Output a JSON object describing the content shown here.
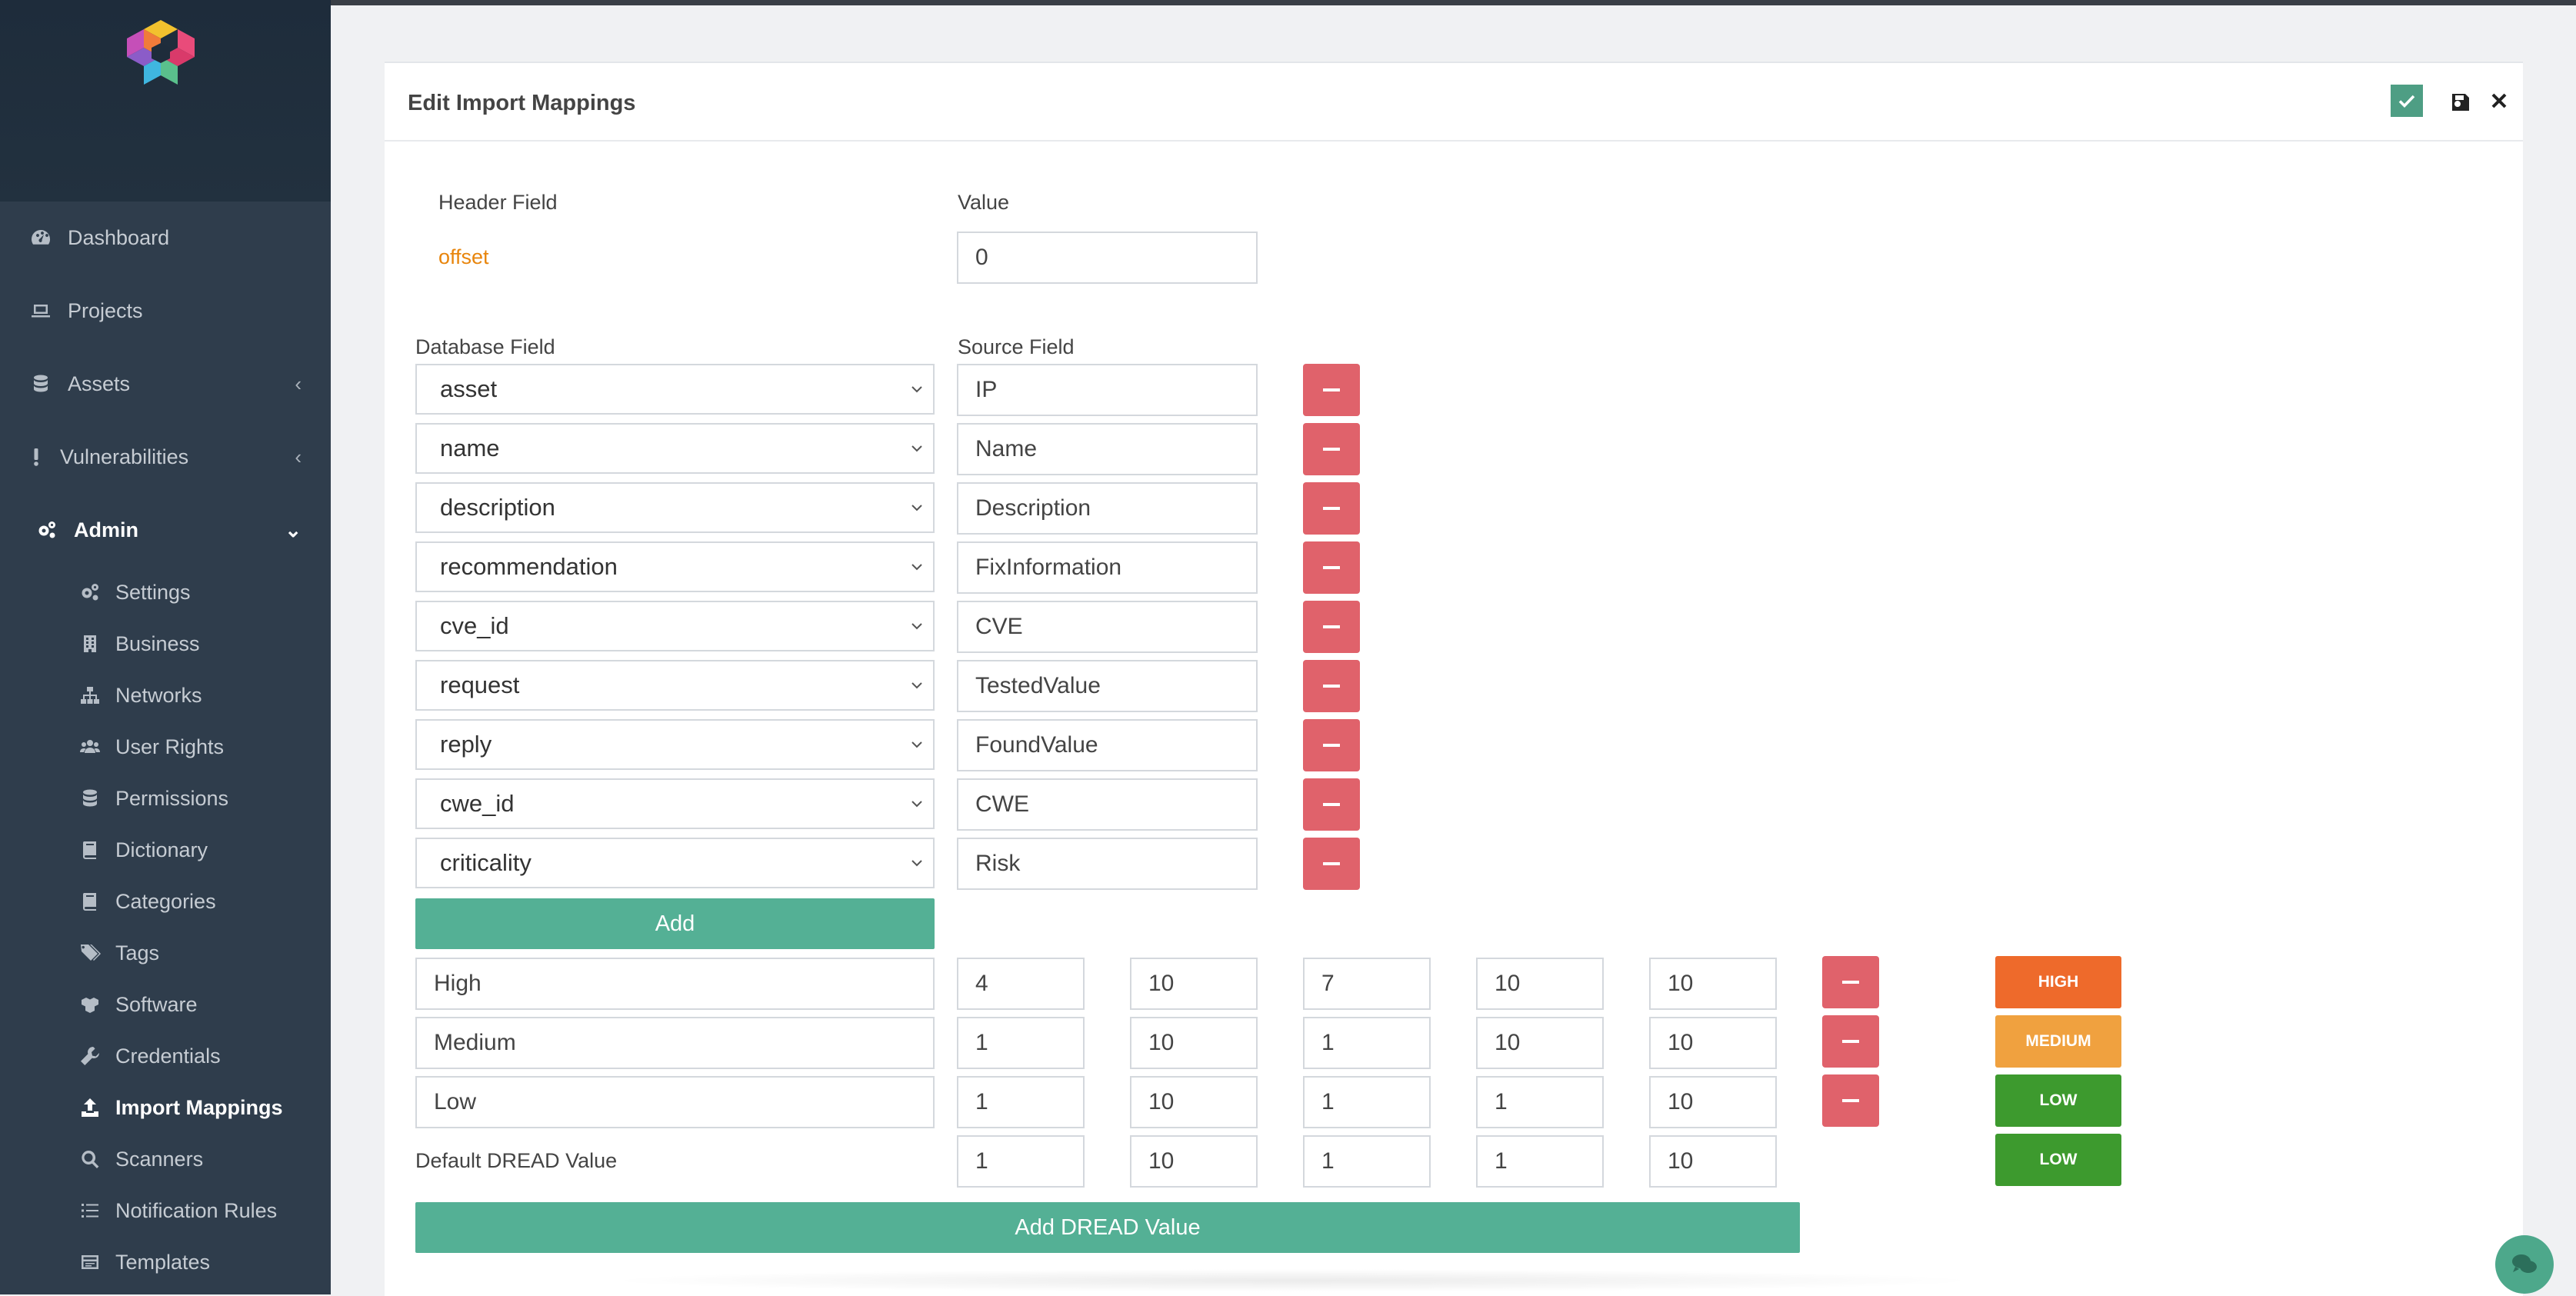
{
  "sidebar": {
    "items": [
      {
        "label": "Dashboard",
        "icon": "gauge-icon"
      },
      {
        "label": "Projects",
        "icon": "laptop-icon"
      },
      {
        "label": "Assets",
        "icon": "database-icon"
      },
      {
        "label": "Vulnerabilities",
        "icon": "exclamation-icon"
      },
      {
        "label": "Admin",
        "icon": "gears-icon"
      }
    ],
    "admin_items": [
      {
        "label": "Settings",
        "icon": "gears-icon"
      },
      {
        "label": "Business",
        "icon": "building-icon"
      },
      {
        "label": "Networks",
        "icon": "sitemap-icon"
      },
      {
        "label": "User Rights",
        "icon": "users-icon"
      },
      {
        "label": "Permissions",
        "icon": "database-icon"
      },
      {
        "label": "Dictionary",
        "icon": "book-icon"
      },
      {
        "label": "Categories",
        "icon": "book-icon"
      },
      {
        "label": "Tags",
        "icon": "tags-icon"
      },
      {
        "label": "Software",
        "icon": "boxes-icon"
      },
      {
        "label": "Credentials",
        "icon": "wrench-icon"
      },
      {
        "label": "Import Mappings",
        "icon": "upload-icon"
      },
      {
        "label": "Scanners",
        "icon": "search-icon"
      },
      {
        "label": "Notification Rules",
        "icon": "list-icon"
      },
      {
        "label": "Templates",
        "icon": "template-icon"
      }
    ]
  },
  "card": {
    "title": "Edit Import Mappings"
  },
  "header_section": {
    "col_header_field": "Header Field",
    "col_value": "Value",
    "field_name": "offset",
    "field_value": "0"
  },
  "mapping_section": {
    "col_database_field": "Database Field",
    "col_source_field": "Source Field",
    "rows": [
      {
        "db": "asset",
        "src": "IP"
      },
      {
        "db": "name",
        "src": "Name"
      },
      {
        "db": "description",
        "src": "Description"
      },
      {
        "db": "recommendation",
        "src": "FixInformation"
      },
      {
        "db": "cve_id",
        "src": "CVE"
      },
      {
        "db": "request",
        "src": "TestedValue"
      },
      {
        "db": "reply",
        "src": "FoundValue"
      },
      {
        "db": "cwe_id",
        "src": "CWE"
      },
      {
        "db": "criticality",
        "src": "Risk"
      }
    ],
    "add_label": "Add"
  },
  "dread_section": {
    "rows": [
      {
        "name": "High",
        "values": [
          "4",
          "10",
          "7",
          "10",
          "10"
        ],
        "badge": "HIGH",
        "badge_color": "#ee6a2b"
      },
      {
        "name": "Medium",
        "values": [
          "1",
          "10",
          "1",
          "10",
          "10"
        ],
        "badge": "MEDIUM",
        "badge_color": "#f0a13f"
      },
      {
        "name": "Low",
        "values": [
          "1",
          "10",
          "1",
          "1",
          "10"
        ],
        "badge": "LOW",
        "badge_color": "#3d9a2e"
      }
    ],
    "default_label": "Default DREAD Value",
    "default_values": [
      "1",
      "10",
      "1",
      "1",
      "10"
    ],
    "default_badge": "LOW",
    "default_badge_color": "#3d9a2e",
    "add_label": "Add DREAD Value"
  },
  "colors": {
    "sidebar_bg": "#2f3d4c",
    "accent_green": "#54b095",
    "danger_red": "#e0626b"
  }
}
